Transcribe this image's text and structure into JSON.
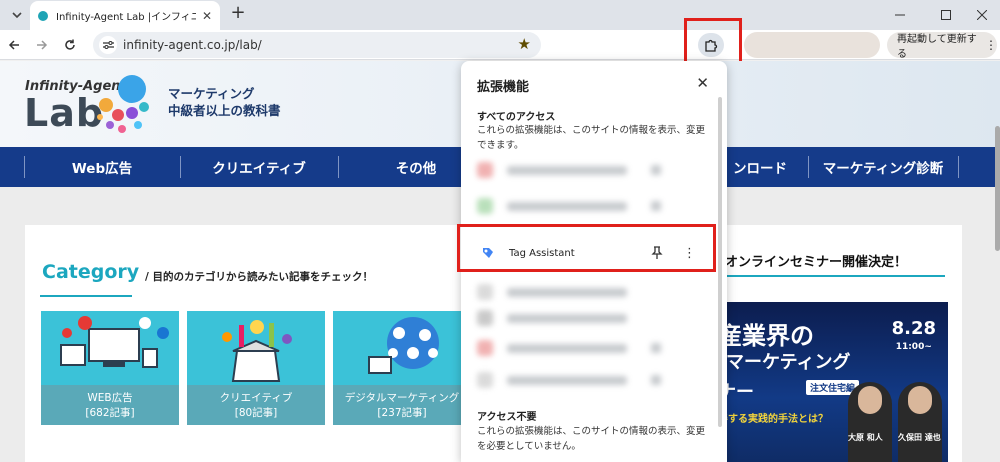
{
  "browser": {
    "tab_title": "Infinity-Agent Lab |インフィニティエ",
    "tab_close": "✕",
    "new_tab": "+",
    "url": "infinity-agent.co.jp/lab/",
    "relaunch_label": "再起動して更新する",
    "icons": [
      "chevron-down-icon",
      "back-arrow-icon",
      "forward-arrow-icon",
      "reload-icon",
      "site-info-icon",
      "star-icon",
      "puzzle-icon",
      "kebab-icon",
      "minimize-icon",
      "maximize-icon",
      "close-icon"
    ]
  },
  "site": {
    "logo_top": "Infinity-Agent",
    "logo_main": "Lab",
    "tagline_1": "マーケティング",
    "tagline_2": "中級者以上の教科書",
    "nav": [
      "Web広告",
      "クリエイティブ",
      "その他",
      "ンロード",
      "マーケティング診断"
    ],
    "category_title": "Category",
    "category_subtitle": "/ 目的のカテゴリから読みたい記事をチェック！",
    "categories": [
      {
        "label": "WEB広告",
        "count": "[682記事]"
      },
      {
        "label": "クリエイティブ",
        "count": "[80記事]"
      },
      {
        "label": "デジタルマーケティング",
        "count": "[237記事]"
      }
    ],
    "seminar_heading": "オンラインセミナー開催決定！",
    "banner": {
      "line1": "産業界の",
      "line2": "ルマーケティング",
      "line3": "ミナー",
      "badge": "注文住宅編",
      "date": "8.28",
      "time": "11:00~",
      "subline": "改善する実践的手法とは？",
      "name1": "大原 和人",
      "name2": "久保田 達也"
    }
  },
  "extensions_popup": {
    "title": "拡張機能",
    "close": "✕",
    "full_access_heading": "すべてのアクセス",
    "full_access_desc": "これらの拡張機能は、このサイトの情報を表示、変更できます。",
    "highlighted_extension": "Tag Assistant",
    "more": "⋮",
    "no_access_heading": "アクセス不要",
    "no_access_desc": "これらの拡張機能は、このサイトの情報の表示、変更を必要としていません。"
  },
  "colors": {
    "accent": "#1ca7bf",
    "nav_bg": "#153b8a",
    "highlight_border": "#e0201b"
  }
}
